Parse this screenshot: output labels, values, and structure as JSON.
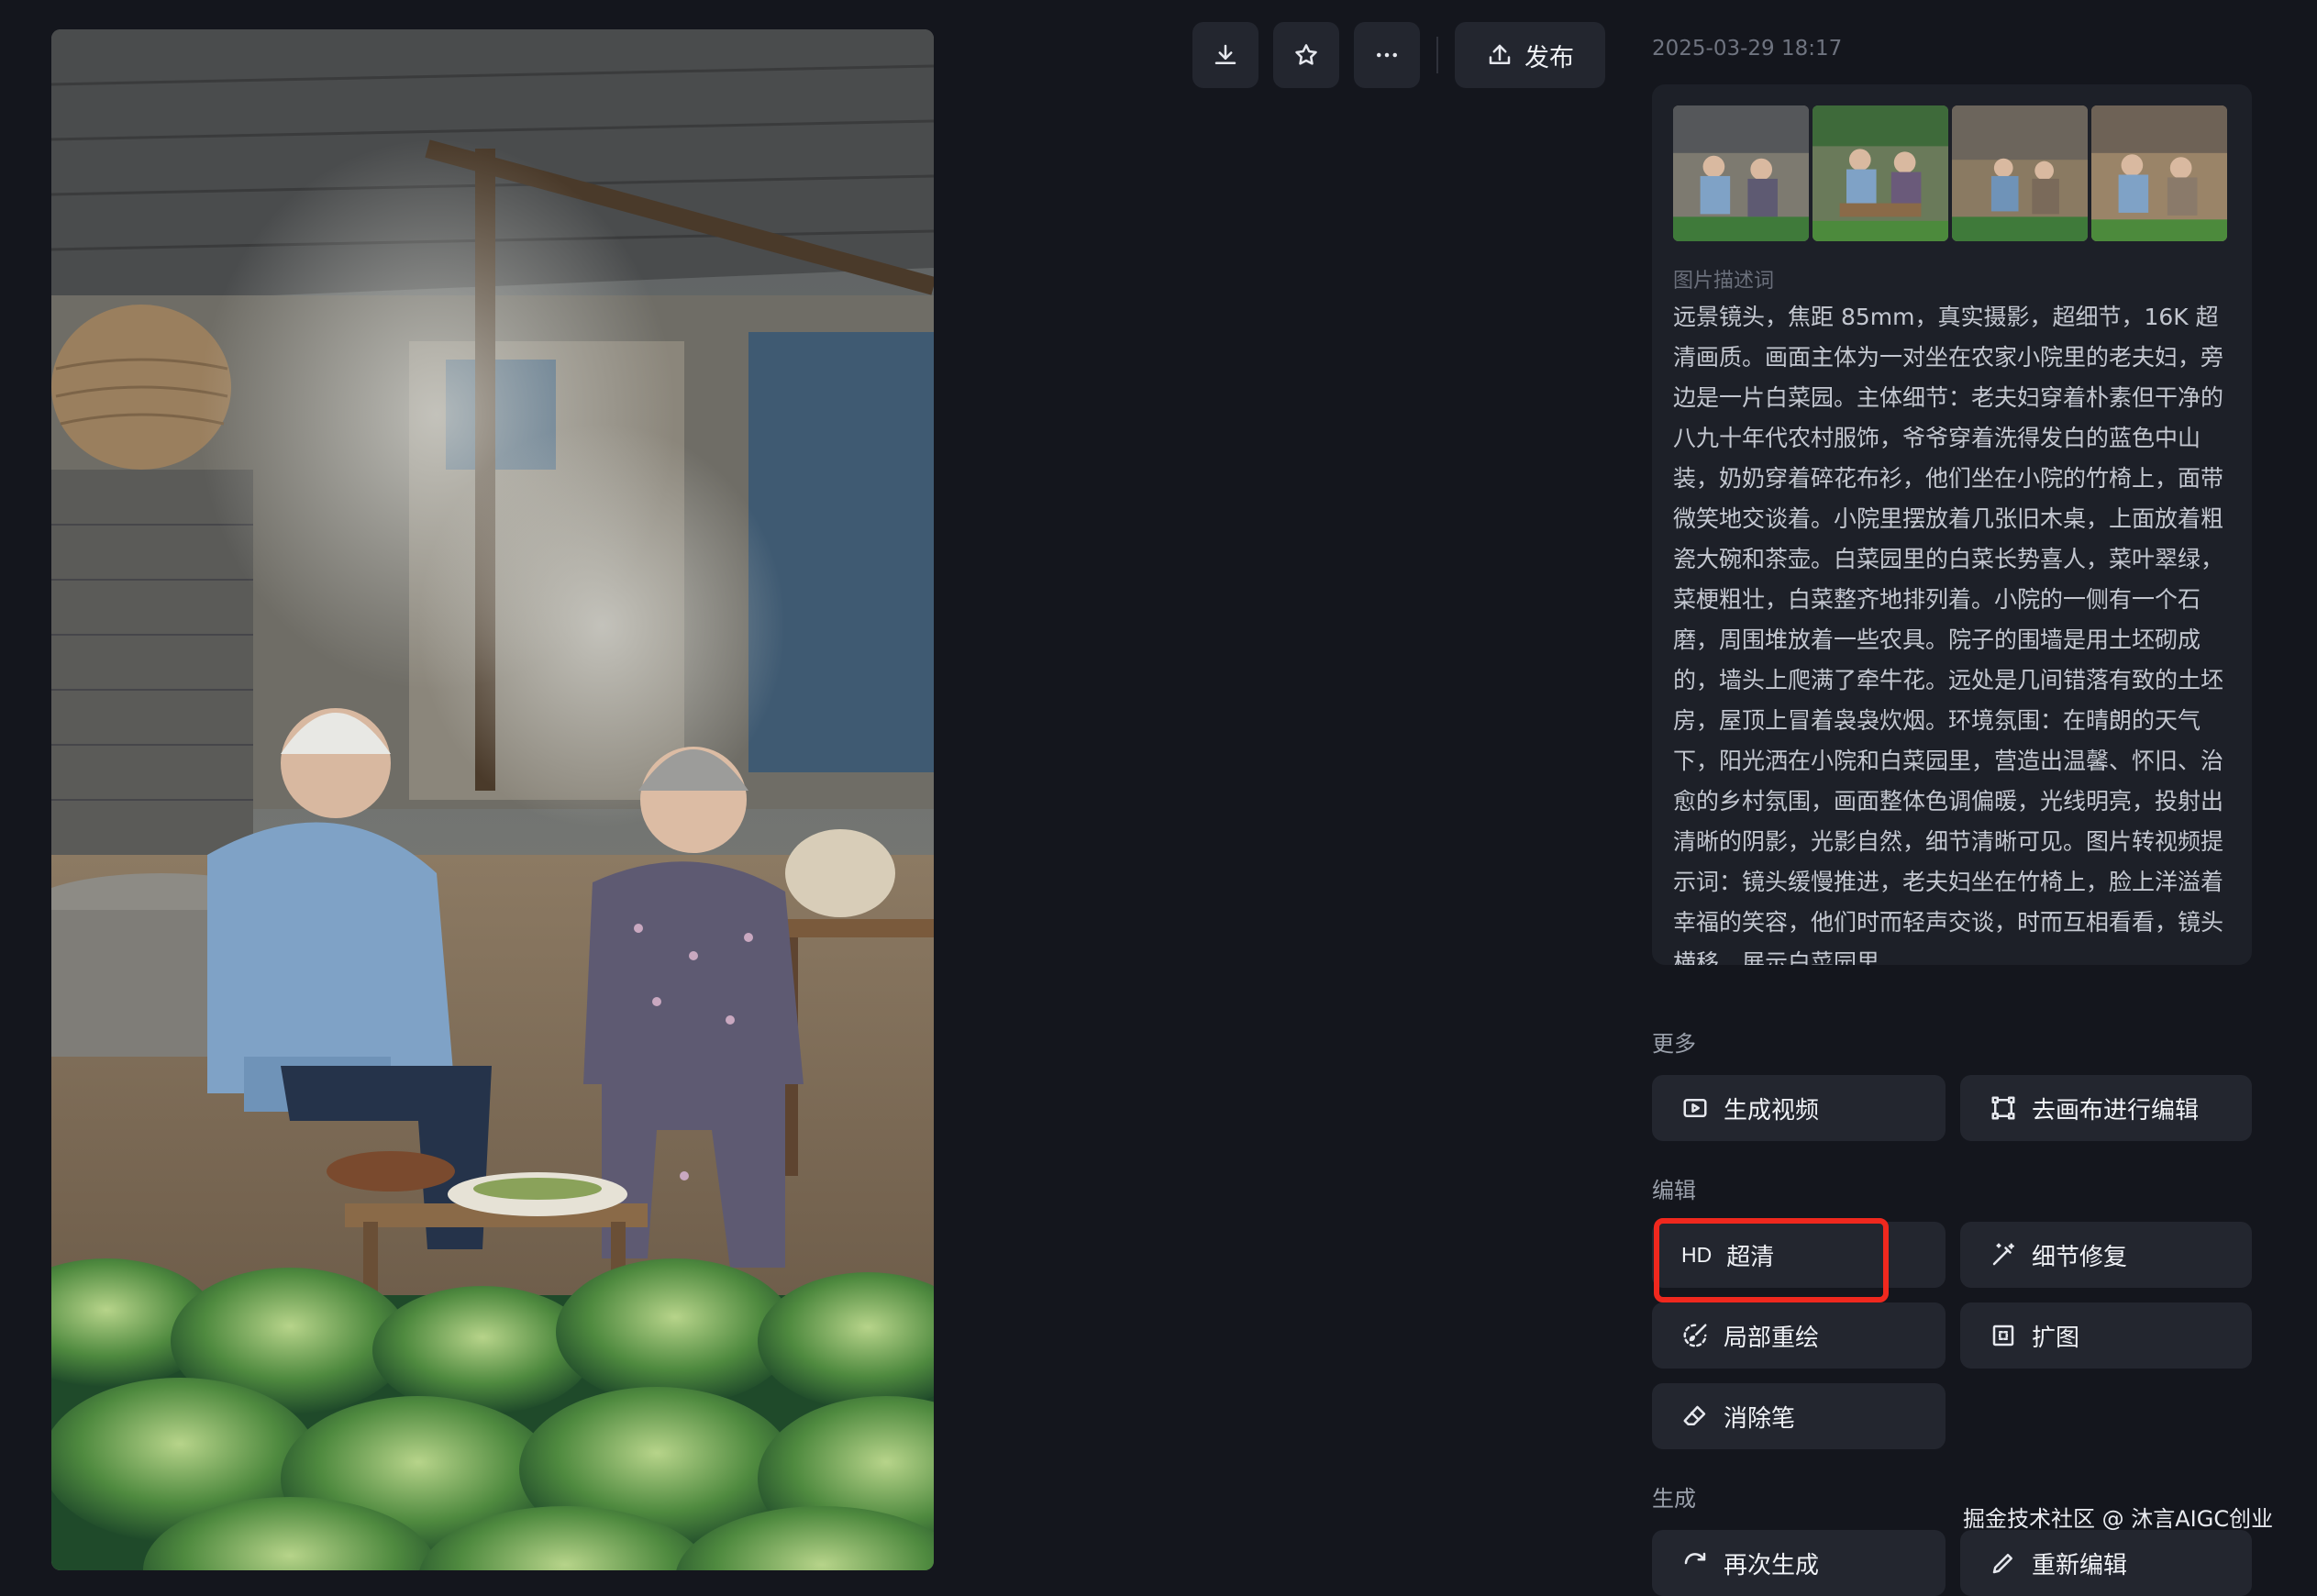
{
  "toolbar": {
    "download_icon": "download-icon",
    "favorite_icon": "star-icon",
    "more_icon": "more-dots-icon",
    "publish_label": "发布"
  },
  "timestamp": "2025-03-29 18:17",
  "prompt_panel": {
    "label": "图片描述词",
    "text": "远景镜头，焦距 85mm，真实摄影，超细节，16K 超清画质。画面主体为一对坐在农家小院里的老夫妇，旁边是一片白菜园。主体细节：老夫妇穿着朴素但干净的八九十年代农村服饰，爷爷穿着洗得发白的蓝色中山装，奶奶穿着碎花布衫，他们坐在小院的竹椅上，面带微笑地交谈着。小院里摆放着几张旧木桌，上面放着粗瓷大碗和茶壶。白菜园里的白菜长势喜人，菜叶翠绿，菜梗粗壮，白菜整齐地排列着。小院的一侧有一个石磨，周围堆放着一些农具。院子的围墙是用土坯砌成的，墙头上爬满了牵牛花。远处是几间错落有致的土坯房，屋顶上冒着袅袅炊烟。环境氛围：在晴朗的天气下，阳光洒在小院和白菜园里，营造出温馨、怀旧、治愈的乡村氛围，画面整体色调偏暖，光线明亮，投射出清晰的阴影，光影自然，细节清晰可见。图片转视频提示词：镜头缓慢推进，老夫妇坐在竹椅上，脸上洋溢着幸福的笑容，他们时而轻声交谈，时而互相看看，镜头横移，展示白菜园里"
  },
  "sections": {
    "more": {
      "label": "更多",
      "generate_video": "生成视频",
      "canvas_edit": "去画布进行编辑"
    },
    "edit": {
      "label": "编辑",
      "hd_tag": "HD",
      "super_res": "超清",
      "detail_fix": "细节修复",
      "inpaint": "局部重绘",
      "expand": "扩图",
      "eraser": "消除笔"
    },
    "generate": {
      "label": "生成",
      "regenerate": "再次生成",
      "reedit": "重新编辑"
    }
  },
  "watermark": "掘金技术社区 @ 沐言AIGC创业",
  "colors": {
    "background": "#14161d",
    "button": "#23262f",
    "panel": "#1d2028",
    "highlight": "#f0281e"
  }
}
